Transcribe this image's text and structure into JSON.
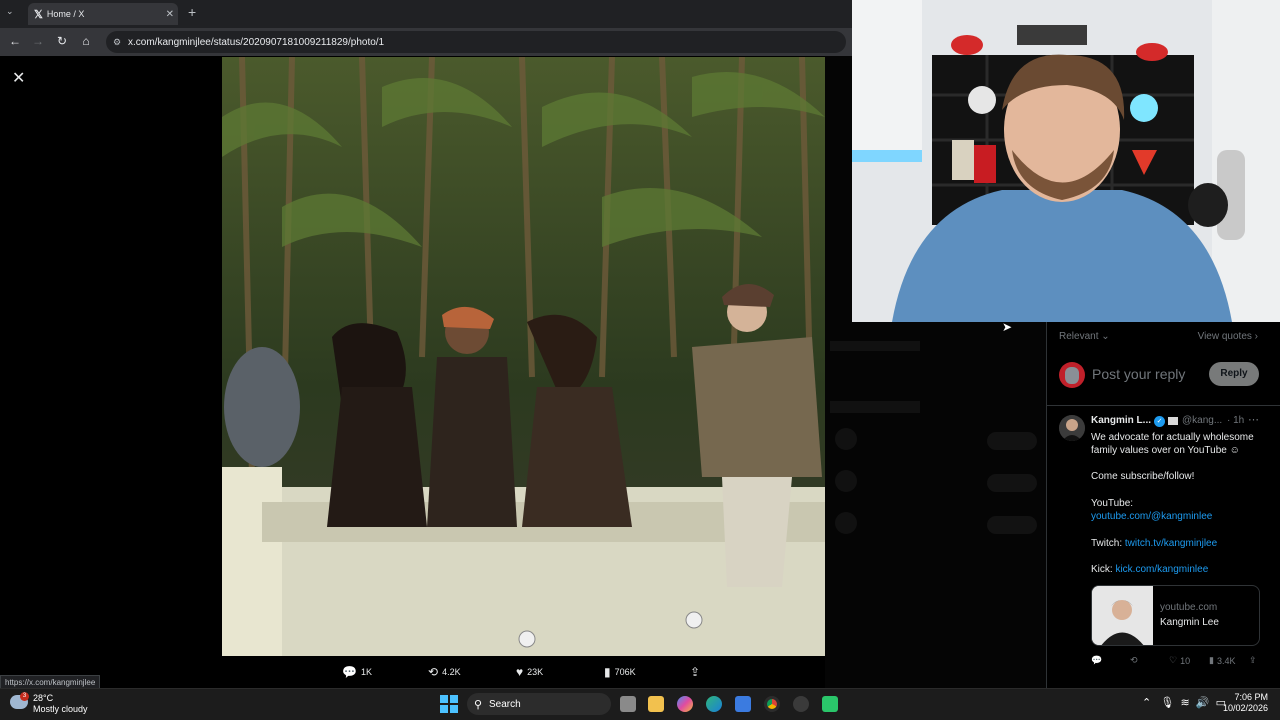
{
  "browser": {
    "tab_title": "Home / X",
    "url": "x.com/kangminjlee/status/2020907181009211829/photo/1",
    "status_url": "https://x.com/kangminjlee"
  },
  "photo_actions": {
    "replies": "1K",
    "reposts": "4.2K",
    "likes": "23K",
    "views": "706K"
  },
  "reply_panel": {
    "sort_label": "Relevant",
    "view_quotes": "View quotes",
    "post_placeholder": "Post your reply",
    "reply_button": "Reply"
  },
  "tweet": {
    "author_name": "Kangmin L...",
    "handle": "@kang...",
    "time": "· 1h",
    "lines": {
      "l1": "We advocate for actually wholesome",
      "l2": "family values over on YouTube ☺",
      "l3": "Come subscribe/follow!",
      "l4": "YouTube:",
      "l5": "youtube.com/@kangminlee",
      "twitch_label": "Twitch:",
      "twitch_link": "twitch.tv/kangminjlee",
      "kick_label": "Kick:",
      "kick_link": "kick.com/kangminlee"
    },
    "card": {
      "domain": "youtube.com",
      "title": "Kangmin Lee"
    },
    "stats": {
      "likes": "10",
      "views": "3.4K"
    }
  },
  "taskbar": {
    "temp": "28°C",
    "condition": "Mostly cloudy",
    "weather_badge": "3",
    "search_label": "Search",
    "time": "7:06 PM",
    "date": "10/02/2026"
  },
  "colors": {
    "accent": "#1d9bf0",
    "muted": "#71767b",
    "border": "#2f3336"
  }
}
